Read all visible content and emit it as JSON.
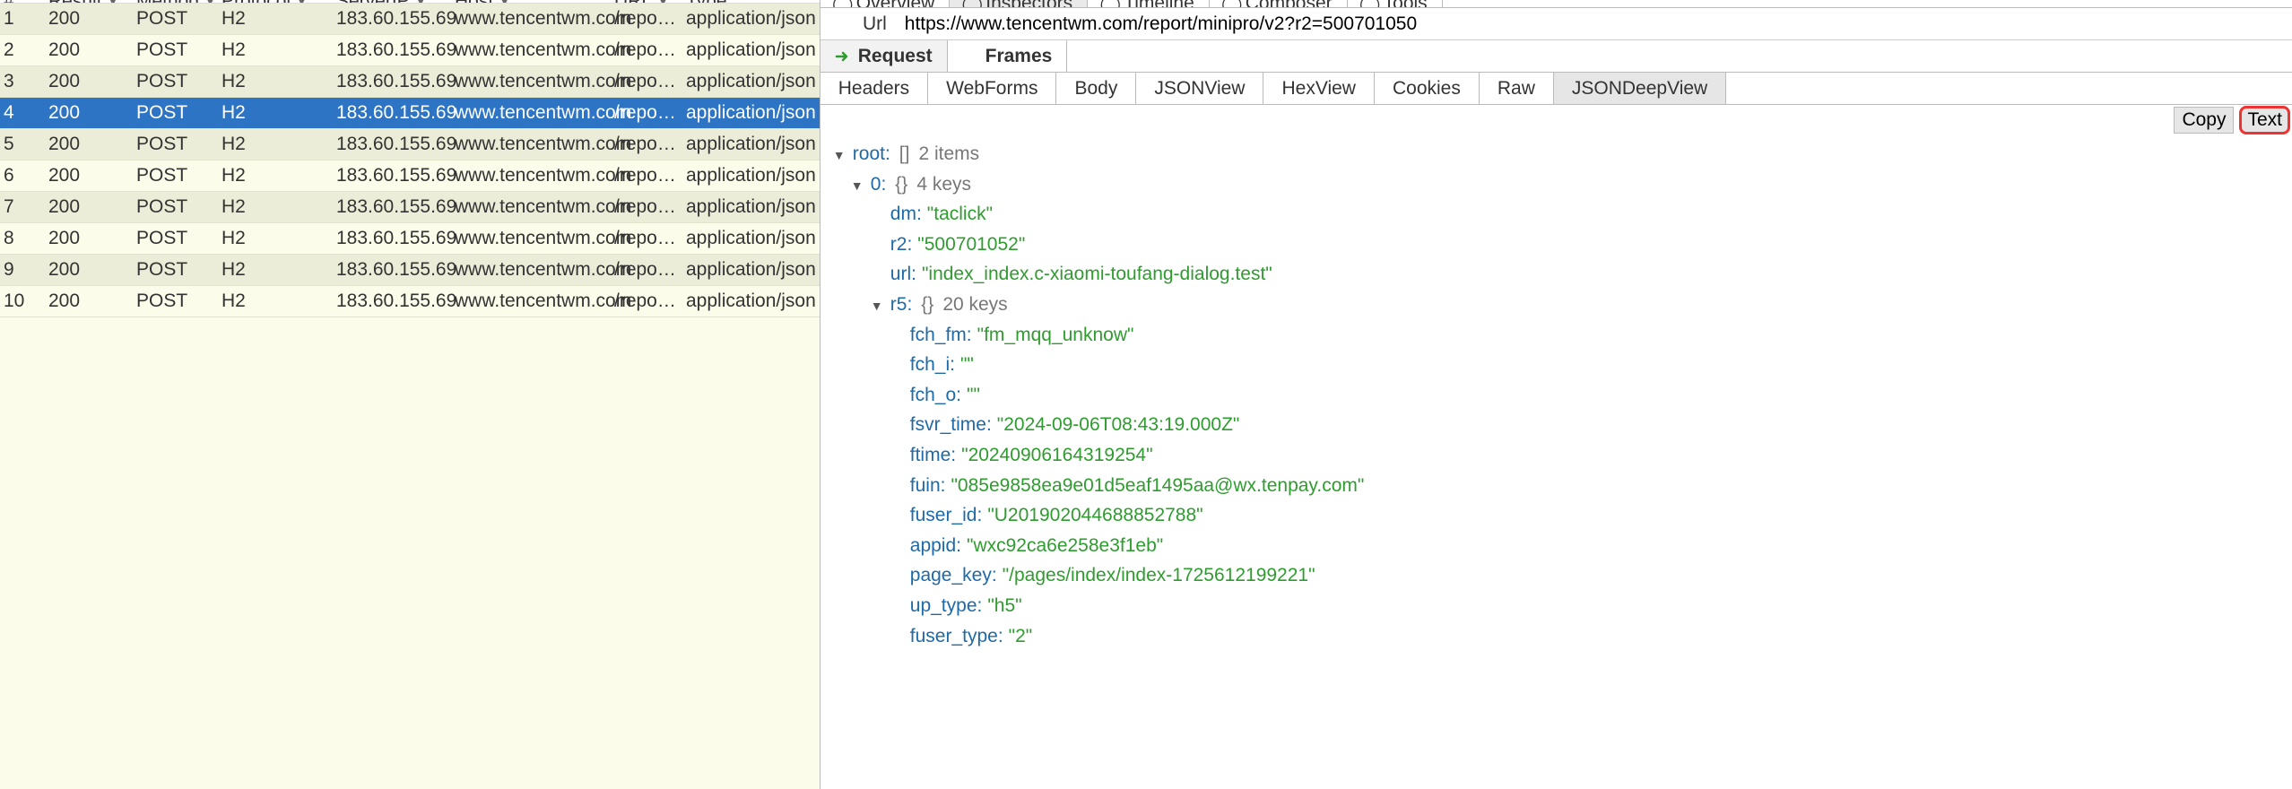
{
  "sessions": {
    "headers": {
      "index": "#",
      "result": "Result",
      "method": "Method",
      "protocol": "Protocol",
      "serverip": "ServerIP",
      "host": "Host",
      "url": "URL",
      "type": "Type"
    },
    "rows": [
      {
        "idx": "1",
        "result": "200",
        "method": "POST",
        "protocol": "H2",
        "serverip": "183.60.155.69",
        "host": "www.tencentwm.com",
        "url": "/report/...",
        "type": "application/json"
      },
      {
        "idx": "2",
        "result": "200",
        "method": "POST",
        "protocol": "H2",
        "serverip": "183.60.155.69",
        "host": "www.tencentwm.com",
        "url": "/report/...",
        "type": "application/json"
      },
      {
        "idx": "3",
        "result": "200",
        "method": "POST",
        "protocol": "H2",
        "serverip": "183.60.155.69",
        "host": "www.tencentwm.com",
        "url": "/report/...",
        "type": "application/json"
      },
      {
        "idx": "4",
        "result": "200",
        "method": "POST",
        "protocol": "H2",
        "serverip": "183.60.155.69",
        "host": "www.tencentwm.com",
        "url": "/report/...",
        "type": "application/json"
      },
      {
        "idx": "5",
        "result": "200",
        "method": "POST",
        "protocol": "H2",
        "serverip": "183.60.155.69",
        "host": "www.tencentwm.com",
        "url": "/report/...",
        "type": "application/json"
      },
      {
        "idx": "6",
        "result": "200",
        "method": "POST",
        "protocol": "H2",
        "serverip": "183.60.155.69",
        "host": "www.tencentwm.com",
        "url": "/report/...",
        "type": "application/json"
      },
      {
        "idx": "7",
        "result": "200",
        "method": "POST",
        "protocol": "H2",
        "serverip": "183.60.155.69",
        "host": "www.tencentwm.com",
        "url": "/report/...",
        "type": "application/json"
      },
      {
        "idx": "8",
        "result": "200",
        "method": "POST",
        "protocol": "H2",
        "serverip": "183.60.155.69",
        "host": "www.tencentwm.com",
        "url": "/report/...",
        "type": "application/json"
      },
      {
        "idx": "9",
        "result": "200",
        "method": "POST",
        "protocol": "H2",
        "serverip": "183.60.155.69",
        "host": "www.tencentwm.com",
        "url": "/report/...",
        "type": "application/json"
      },
      {
        "idx": "10",
        "result": "200",
        "method": "POST",
        "protocol": "H2",
        "serverip": "183.60.155.69",
        "host": "www.tencentwm.com",
        "url": "/report/...",
        "type": "application/json"
      }
    ],
    "selected_index": 3
  },
  "inspector": {
    "top_tabs": [
      "Overview",
      "Inspectors",
      "Timeline",
      "Composer",
      "Tools"
    ],
    "top_active": 1,
    "url_label": "Url",
    "url_value": "https://www.tencentwm.com/report/minipro/v2?r2=500701050",
    "req_tabs": [
      "Request",
      "Frames"
    ],
    "req_active": 1,
    "view_tabs": [
      "Headers",
      "WebForms",
      "Body",
      "JSONView",
      "HexView",
      "Cookies",
      "Raw",
      "JSONDeepView"
    ],
    "view_active": 7,
    "actions": {
      "copy": "Copy",
      "text": "Text"
    },
    "tree": {
      "root_label": "root:",
      "root_meta_brackets": "[]",
      "root_meta_count": "2 items",
      "items": [
        {
          "key": "0:",
          "meta_brackets": "{}",
          "meta_count": "4 keys",
          "leaves": [
            {
              "key": "dm:",
              "value": "\"taclick\""
            },
            {
              "key": "r2:",
              "value": "\"500701052\""
            },
            {
              "key": "url:",
              "value": "\"index_index.c-xiaomi-toufang-dialog.test\""
            }
          ],
          "child": {
            "key": "r5:",
            "meta_brackets": "{}",
            "meta_count": "20 keys",
            "leaves": [
              {
                "key": "fch_fm:",
                "value": "\"fm_mqq_unknow\""
              },
              {
                "key": "fch_i:",
                "value": "\"\""
              },
              {
                "key": "fch_o:",
                "value": "\"\""
              },
              {
                "key": "fsvr_time:",
                "value": "\"2024-09-06T08:43:19.000Z\""
              },
              {
                "key": "ftime:",
                "value": "\"20240906164319254\""
              },
              {
                "key": "fuin:",
                "value": "\"085e9858ea9e01d5eaf1495aa@wx.tenpay.com\""
              },
              {
                "key": "fuser_id:",
                "value": "\"U201902044688852788\""
              },
              {
                "key": "appid:",
                "value": "\"wxc92ca6e258e3f1eb\""
              },
              {
                "key": "page_key:",
                "value": "\"/pages/index/index-1725612199221\""
              },
              {
                "key": "up_type:",
                "value": "\"h5\""
              },
              {
                "key": "fuser_type:",
                "value": "\"2\""
              }
            ]
          }
        }
      ]
    }
  }
}
